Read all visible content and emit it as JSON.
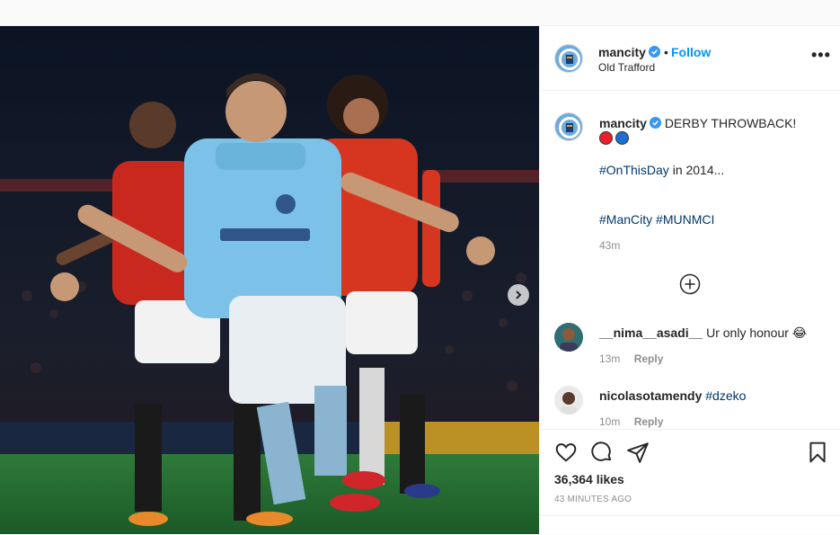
{
  "post": {
    "username": "mancity",
    "follow_label": "Follow",
    "separator": "•",
    "location": "Old Trafford",
    "more_label": "•••"
  },
  "caption": {
    "username": "mancity",
    "headline": "DERBY THROWBACK!",
    "ball_colors": [
      "#e8202a",
      "#1c6fd1"
    ],
    "line1": "#OnThisDay",
    "line1_rest": " in 2014...",
    "tag1": "#ManCity",
    "tag2": "#MUNMCI",
    "time": "43m"
  },
  "comments": [
    {
      "username": "__nima__asadi__",
      "text": "Ur only honour 😂",
      "time": "13m",
      "reply": "Reply"
    },
    {
      "username": "nicolasotamendy",
      "text": "#dzeko",
      "time": "10m",
      "reply": "Reply"
    }
  ],
  "actions": {
    "likes": "36,364 likes",
    "posted": "43 MINUTES AGO"
  },
  "colors": {
    "link_blue": "#0095f6",
    "hashtag": "#00376b",
    "city_blue": "#6cabdd",
    "united_red": "#da291c"
  }
}
